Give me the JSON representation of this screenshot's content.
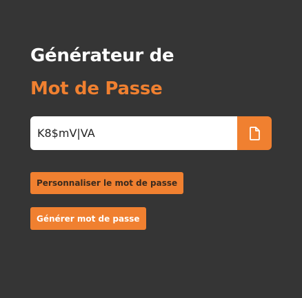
{
  "header": {
    "title_line1": "Générateur de",
    "title_line2": "Mot de Passe"
  },
  "password": {
    "value": "K8$mV|VA"
  },
  "copy_button": {
    "icon": "file-copy-icon"
  },
  "actions": {
    "customize_label": "Personnaliser le mot de passe",
    "generate_label": "Générer mot de passe"
  },
  "colors": {
    "background": "#353535",
    "accent": "#f08030",
    "title_primary": "#ffffff",
    "field_background": "#ffffff"
  }
}
